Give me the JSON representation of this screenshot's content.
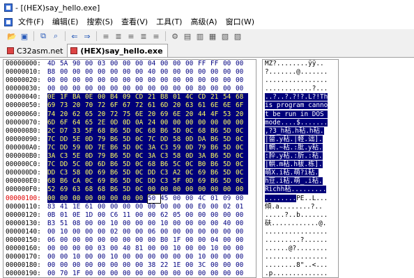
{
  "window": {
    "title": " - [(HEX)say_hello.exe]"
  },
  "menu": [
    "文件(F)",
    "编辑(E)",
    "搜索(S)",
    "查看(V)",
    "工具(T)",
    "高级(A)",
    "窗口(W)"
  ],
  "toolbar_icons": [
    "open-icon",
    "save-icon",
    "copy-icon",
    "find-icon",
    "back-icon",
    "forward-icon",
    "tool1-icon",
    "tool2-icon",
    "tool3-icon",
    "tool4-icon",
    "tool5-icon",
    "settings-icon",
    "tool6-icon",
    "tool7-icon",
    "tool8-icon",
    "tool9-icon",
    "tool10-icon"
  ],
  "tabs": [
    {
      "label": "C32asm.net",
      "active": false
    },
    {
      "label": "(HEX)say_hello.exe",
      "active": true
    }
  ],
  "hex_rows": [
    {
      "addr": "00000000:",
      "bytes": [
        "4D",
        "5A",
        "90",
        "00",
        "03",
        "00",
        "00",
        "00",
        "04",
        "00",
        "00",
        "00",
        "FF",
        "FF",
        "00",
        "00"
      ],
      "sel_from": 16,
      "ascii": "MZ?........ÿÿ..",
      "ascii_sel_from": 99
    },
    {
      "addr": "00000010:",
      "bytes": [
        "B8",
        "00",
        "00",
        "00",
        "00",
        "00",
        "00",
        "00",
        "40",
        "00",
        "00",
        "00",
        "00",
        "00",
        "00",
        "00"
      ],
      "sel_from": 16,
      "ascii": "?.......@.......",
      "ascii_sel_from": 99
    },
    {
      "addr": "00000020:",
      "bytes": [
        "00",
        "00",
        "00",
        "00",
        "00",
        "00",
        "00",
        "00",
        "00",
        "00",
        "00",
        "00",
        "00",
        "00",
        "00",
        "00"
      ],
      "sel_from": 16,
      "ascii": "................",
      "ascii_sel_from": 99
    },
    {
      "addr": "00000030:",
      "bytes": [
        "00",
        "00",
        "00",
        "00",
        "00",
        "00",
        "00",
        "00",
        "00",
        "00",
        "00",
        "00",
        "80",
        "00",
        "00",
        "00"
      ],
      "sel_from": 16,
      "ascii": "............?...",
      "ascii_sel_from": 99
    },
    {
      "addr": "00000040:",
      "bytes": [
        "0E",
        "1F",
        "BA",
        "0E",
        "00",
        "B4",
        "09",
        "CD",
        "21",
        "B8",
        "01",
        "4C",
        "CD",
        "21",
        "54",
        "68"
      ],
      "sel_from": 0,
      "ascii": "..?..?.?!?.L?!Th",
      "ascii_sel_from": 0
    },
    {
      "addr": "00000050:",
      "bytes": [
        "69",
        "73",
        "20",
        "70",
        "72",
        "6F",
        "67",
        "72",
        "61",
        "6D",
        "20",
        "63",
        "61",
        "6E",
        "6E",
        "6F"
      ],
      "sel_from": 0,
      "ascii": "is program canno",
      "ascii_sel_from": 0
    },
    {
      "addr": "00000060:",
      "bytes": [
        "74",
        "20",
        "62",
        "65",
        "20",
        "72",
        "75",
        "6E",
        "20",
        "69",
        "6E",
        "20",
        "44",
        "4F",
        "53",
        "20"
      ],
      "sel_from": 0,
      "ascii": "t be run in DOS ",
      "ascii_sel_from": 0
    },
    {
      "addr": "00000070:",
      "bytes": [
        "6D",
        "6F",
        "64",
        "65",
        "2E",
        "0D",
        "0D",
        "0A",
        "24",
        "00",
        "00",
        "00",
        "00",
        "00",
        "00",
        "00"
      ],
      "sel_from": 0,
      "ascii": "mode....$.......",
      "ascii_sel_from": 0
    },
    {
      "addr": "00000080:",
      "bytes": [
        "2C",
        "D7",
        "33",
        "5F",
        "68",
        "B6",
        "5D",
        "0C",
        "68",
        "B6",
        "5D",
        "0C",
        "68",
        "B6",
        "5D",
        "0C"
      ],
      "sel_from": 0,
      "ascii": ",?3_h秥.h秥.h秥.",
      "ascii_sel_from": 0
    },
    {
      "addr": "00000090:",
      "bytes": [
        "7C",
        "DD",
        "5E",
        "0D",
        "79",
        "B6",
        "5D",
        "0C",
        "7C",
        "DD",
        "58",
        "0D",
        "DA",
        "B6",
        "5D",
        "0C"
      ],
      "sel_from": 0,
      "ascii": "|蒥.y秥.|軽.诎].",
      "ascii_sel_from": 0
    },
    {
      "addr": "000000A0:",
      "bytes": [
        "7C",
        "DD",
        "59",
        "0D",
        "7E",
        "B6",
        "5D",
        "0C",
        "3A",
        "C3",
        "59",
        "0D",
        "79",
        "B6",
        "5D",
        "0C"
      ],
      "sel_from": 0,
      "ascii": "|輞.~秥.:肶.y秥.",
      "ascii_sel_from": 0
    },
    {
      "addr": "000000B0:",
      "bytes": [
        "3A",
        "C3",
        "5E",
        "0D",
        "79",
        "B6",
        "5D",
        "0C",
        "3A",
        "C3",
        "58",
        "0D",
        "3A",
        "B6",
        "5D",
        "0C"
      ],
      "sel_from": 0,
      "ascii": ":肸.y秥.:肵.:秥.",
      "ascii_sel_from": 0
    },
    {
      "addr": "000000C0:",
      "bytes": [
        "7C",
        "DD",
        "5C",
        "0D",
        "6D",
        "B6",
        "5D",
        "0C",
        "68",
        "B6",
        "5C",
        "0C",
        "B0",
        "B6",
        "5D",
        "0C"
      ],
      "sel_from": 0,
      "ascii": "|輁.m秥.h秡.栋].",
      "ascii_sel_from": 0
    },
    {
      "addr": "000000D0:",
      "bytes": [
        "DD",
        "C3",
        "58",
        "0D",
        "69",
        "B6",
        "5D",
        "0C",
        "DD",
        "C3",
        "A2",
        "0C",
        "69",
        "B6",
        "5D",
        "0C"
      ],
      "sel_from": 0,
      "ascii": "萌X.i秥.萌?i秥.",
      "ascii_sel_from": 0
    },
    {
      "addr": "000000E0:",
      "bytes": [
        "68",
        "B6",
        "CA",
        "0C",
        "69",
        "B6",
        "5D",
        "0C",
        "DD",
        "C3",
        "5F",
        "0D",
        "69",
        "B6",
        "5D",
        "0C"
      ],
      "sel_from": 0,
      "ascii": "h豆.i秥.萌_.i秥.",
      "ascii_sel_from": 0
    },
    {
      "addr": "000000F0:",
      "bytes": [
        "52",
        "69",
        "63",
        "68",
        "68",
        "B6",
        "5D",
        "0C",
        "00",
        "00",
        "00",
        "00",
        "00",
        "00",
        "00",
        "00"
      ],
      "sel_from": 0,
      "ascii": "Richh秥.........",
      "ascii_sel_from": 0
    },
    {
      "addr": "00000100:",
      "bytes": [
        "00",
        "00",
        "00",
        "00",
        "00",
        "00",
        "00",
        "00",
        "50",
        "45",
        "00",
        "00",
        "4C",
        "01",
        "09",
        "00"
      ],
      "sel_from": 0,
      "sel_to": 8,
      "ascii": "........PE..L...",
      "ascii_sel_from": 0,
      "ascii_sel_to": 8,
      "current": true
    },
    {
      "addr": "00000110:",
      "bytes": [
        "83",
        "41",
        "1E",
        "61",
        "00",
        "00",
        "00",
        "00",
        "00",
        "00",
        "00",
        "00",
        "E0",
        "00",
        "02",
        "01"
      ],
      "sel_from": 16,
      "ascii": "傾.a........?..",
      "ascii_sel_from": 99
    },
    {
      "addr": "00000120:",
      "bytes": [
        "0B",
        "01",
        "0E",
        "1D",
        "00",
        "C6",
        "11",
        "00",
        "00",
        "62",
        "05",
        "00",
        "00",
        "00",
        "00",
        "00"
      ],
      "sel_from": 16,
      "ascii": ".....?..b.......",
      "ascii_sel_from": 99
    },
    {
      "addr": "00000130:",
      "bytes": [
        "B3",
        "51",
        "08",
        "00",
        "00",
        "10",
        "00",
        "00",
        "00",
        "10",
        "00",
        "00",
        "00",
        "00",
        "40",
        "00"
      ],
      "sel_from": 16,
      "ascii": "砆............@.",
      "ascii_sel_from": 99
    },
    {
      "addr": "00000140:",
      "bytes": [
        "00",
        "10",
        "00",
        "00",
        "00",
        "02",
        "00",
        "00",
        "06",
        "00",
        "00",
        "00",
        "00",
        "00",
        "00",
        "00"
      ],
      "sel_from": 16,
      "ascii": "................",
      "ascii_sel_from": 99
    },
    {
      "addr": "00000150:",
      "bytes": [
        "06",
        "00",
        "00",
        "00",
        "00",
        "00",
        "00",
        "00",
        "00",
        "B0",
        "1F",
        "00",
        "00",
        "04",
        "00",
        "00"
      ],
      "sel_from": 16,
      "ascii": ".........?......",
      "ascii_sel_from": 99
    },
    {
      "addr": "00000160:",
      "bytes": [
        "00",
        "00",
        "00",
        "00",
        "03",
        "00",
        "40",
        "81",
        "00",
        "00",
        "10",
        "00",
        "00",
        "10",
        "00",
        "00"
      ],
      "sel_from": 16,
      "ascii": "......@?........",
      "ascii_sel_from": 99
    },
    {
      "addr": "00000170:",
      "bytes": [
        "00",
        "00",
        "10",
        "00",
        "00",
        "10",
        "00",
        "00",
        "00",
        "00",
        "00",
        "00",
        "10",
        "00",
        "00",
        "00"
      ],
      "sel_from": 16,
      "ascii": "................",
      "ascii_sel_from": 99
    },
    {
      "addr": "00000180:",
      "bytes": [
        "00",
        "00",
        "00",
        "00",
        "00",
        "00",
        "00",
        "00",
        "38",
        "22",
        "1E",
        "00",
        "3C",
        "00",
        "00",
        "00"
      ],
      "sel_from": 16,
      "ascii": "........8\"..<...",
      "ascii_sel_from": 99
    },
    {
      "addr": "00000190:",
      "bytes": [
        "00",
        "70",
        "1F",
        "00",
        "00",
        "00",
        "00",
        "00",
        "00",
        "00",
        "00",
        "00",
        "00",
        "00",
        "00",
        "00"
      ],
      "sel_from": 16,
      "ascii": ".p..............",
      "ascii_sel_from": 99
    }
  ]
}
